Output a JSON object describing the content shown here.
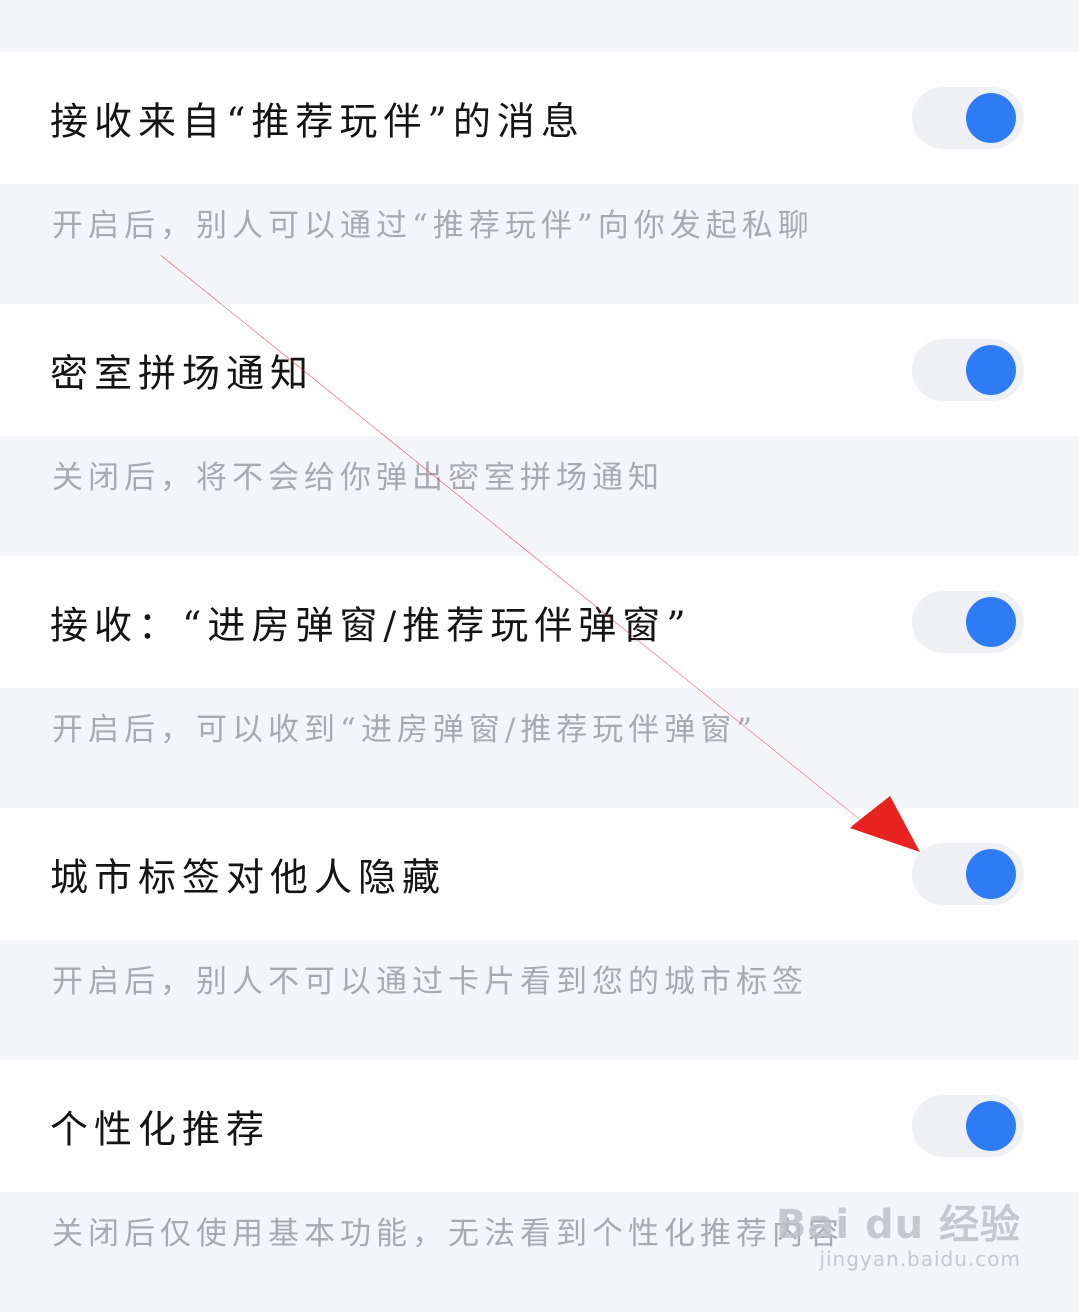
{
  "settings": [
    {
      "title": "接收来自“推荐玩伴”的消息",
      "description": "开启后，别人可以通过“推荐玩伴”向你发起私聊",
      "enabled": true
    },
    {
      "title": "密室拼场通知",
      "description": "关闭后，将不会给你弹出密室拼场通知",
      "enabled": true
    },
    {
      "title": "接收：“进房弹窗/推荐玩伴弹窗”",
      "description": "开启后，可以收到“进房弹窗/推荐玩伴弹窗”",
      "enabled": true
    },
    {
      "title": "城市标签对他人隐藏",
      "description": "开启后，别人不可以通过卡片看到您的城市标签",
      "enabled": true
    },
    {
      "title": "个性化推荐",
      "description": "关闭后仅使用基本功能，无法看到个性化推荐内容",
      "enabled": true
    }
  ],
  "colors": {
    "toggle_on": "#2f7bf6",
    "toggle_track": "#eff0f4",
    "annotation_arrow": "#e8231f"
  },
  "watermark": {
    "logo": "Bai du 经验",
    "url": "jingyan.baidu.com"
  }
}
